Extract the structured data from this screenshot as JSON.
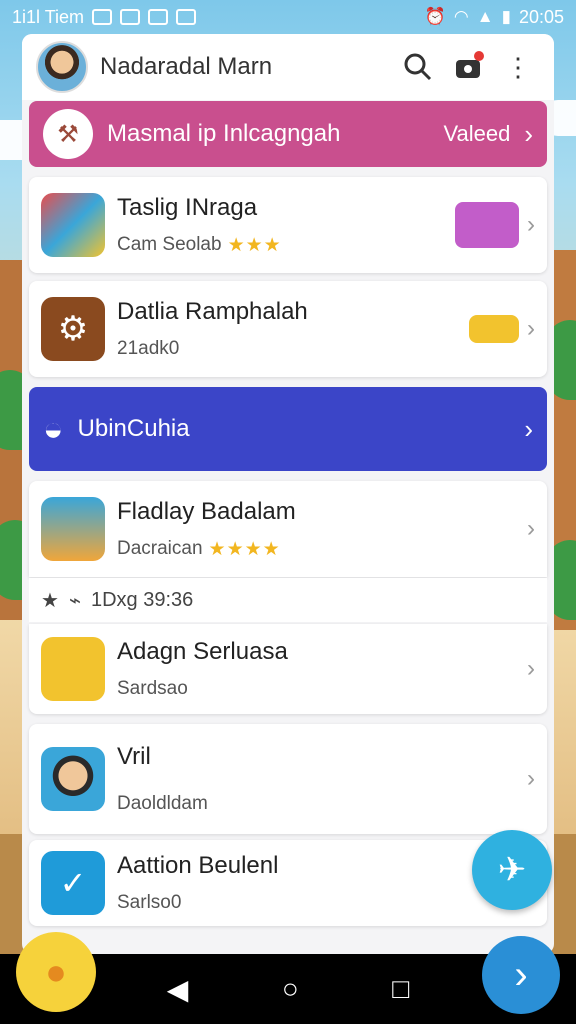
{
  "status_bar": {
    "carrier": "1i1l Tiem",
    "time": "20:05"
  },
  "header": {
    "title": "Nadaradal Marn"
  },
  "banner_pink": {
    "title": "Masmal ip Inlcagngah",
    "action": "Valeed"
  },
  "items": [
    {
      "title": "Taslig INraga",
      "subtitle": "Cam Seolab",
      "rating": "★★★"
    },
    {
      "title": "Datlia Ramphalah",
      "subtitle": "21adk0"
    },
    {
      "title": "Fladlay Badalam",
      "subtitle": "Dacraican",
      "rating": "★★★★"
    },
    {
      "title": "Adagn Serluasa",
      "subtitle": "Sardsao"
    },
    {
      "title": "Vril",
      "subtitle": "Daoldldam"
    },
    {
      "title": "Aattion Beulenl",
      "subtitle": "Sarlso0"
    }
  ],
  "banner_blue": {
    "title": "UbinCuhia"
  },
  "meta": {
    "text": "1Dxg 39:36"
  },
  "colors": {
    "pink": "#c94f8e",
    "blue": "#3b45c8",
    "fab": "#2fb1e0"
  }
}
